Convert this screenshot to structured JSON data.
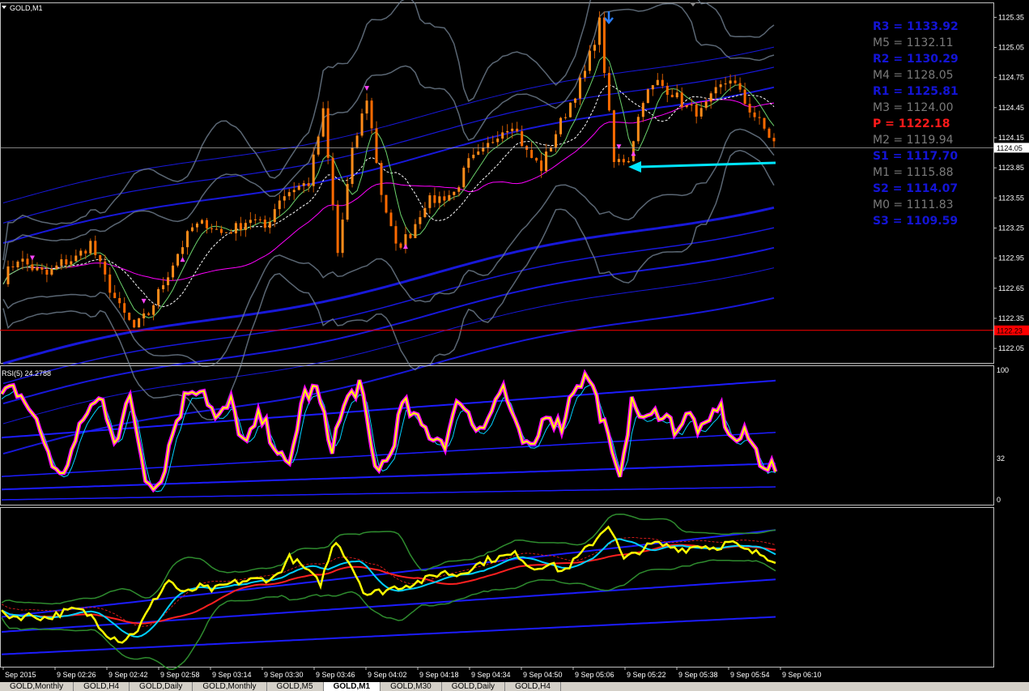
{
  "title": "GOLD,M1",
  "colors": {
    "background": "#000000",
    "axis": "#c0c0c0",
    "up_candle": "#ff8c1a",
    "down_candle": "#ff6a00",
    "bollinger": "#708090",
    "envelope": "#1c1cff",
    "magenta_ma": "#ff00ff",
    "white_ma": "#ffffff",
    "green_ma": "#6bd26b",
    "rsi_yellow": "#ffff00",
    "rsi_cyan": "#00d0ff",
    "red_line": "#ff0000",
    "cyan_arrow": "#00e5ff"
  },
  "chart_data": [
    {
      "type": "candlestick",
      "title": "GOLD,M1",
      "y_ticks": [
        "1125.35",
        "1125.05",
        "1124.75",
        "1124.45",
        "1124.15",
        "1123.85",
        "1123.55",
        "1123.25",
        "1122.95",
        "1122.65",
        "1122.35",
        "1122.05"
      ],
      "y_range": [
        1121.97,
        1125.45
      ],
      "current_price": "1124.05",
      "current_price_value": 1124.05,
      "red_level": "1122.23",
      "red_level_value": 1122.23,
      "x_ticks": [
        "Sep 2015",
        "9 Sep 02:26",
        "9 Sep 02:42",
        "9 Sep 02:58",
        "9 Sep 03:14",
        "9 Sep 03:30",
        "9 Sep 03:46",
        "9 Sep 04:02",
        "9 Sep 04:18",
        "9 Sep 04:34",
        "9 Sep 04:50",
        "9 Sep 05:06",
        "9 Sep 05:22",
        "9 Sep 05:38",
        "9 Sep 05:54",
        "9 Sep 06:10"
      ],
      "price_path": [
        1122.75,
        1122.95,
        1122.85,
        1122.78,
        1122.9,
        1122.95,
        1123.1,
        1122.75,
        1122.45,
        1122.25,
        1122.4,
        1122.7,
        1123.0,
        1123.25,
        1123.3,
        1123.2,
        1123.25,
        1123.35,
        1123.25,
        1123.55,
        1123.65,
        1123.7,
        1124.4,
        1123.0,
        1124.0,
        1124.55,
        1123.6,
        1123.05,
        1123.2,
        1123.5,
        1123.55,
        1123.6,
        1123.9,
        1124.0,
        1124.2,
        1124.3,
        1124.0,
        1123.85,
        1124.2,
        1124.5,
        1124.8,
        1125.3,
        1123.9,
        1123.95,
        1124.55,
        1124.7,
        1124.6,
        1124.45,
        1124.4,
        1124.6,
        1124.75,
        1124.5,
        1124.3,
        1124.1
      ],
      "pivots": [
        {
          "label": "R3 = 1133.92",
          "color": "#1414d6"
        },
        {
          "label": "M5 = 1132.11",
          "color": "#7a7a7a"
        },
        {
          "label": "R2 = 1130.29",
          "color": "#1414d6"
        },
        {
          "label": "M4 = 1128.05",
          "color": "#7a7a7a"
        },
        {
          "label": "R1 = 1125.81",
          "color": "#1414d6"
        },
        {
          "label": "M3 = 1124.00",
          "color": "#7a7a7a"
        },
        {
          "label": "P  = 1122.18",
          "color": "#ff1a1a"
        },
        {
          "label": "M2 = 1119.94",
          "color": "#7a7a7a"
        },
        {
          "label": "S1 = 1117.70",
          "color": "#1414d6"
        },
        {
          "label": "M1 = 1115.88",
          "color": "#7a7a7a"
        },
        {
          "label": "S2 = 1114.07",
          "color": "#1414d6"
        },
        {
          "label": "M0 = 1111.83",
          "color": "#7a7a7a"
        },
        {
          "label": "S3 = 1109.59",
          "color": "#1414d6"
        }
      ]
    },
    {
      "type": "line",
      "title": "RSI(5) 24.2788",
      "y_ticks": [
        "100",
        "32",
        "0"
      ],
      "y_tick_values": [
        100,
        32,
        0
      ],
      "y_range": [
        0,
        100
      ],
      "series": [
        {
          "values": [
            80,
            85,
            70,
            45,
            15,
            40,
            70,
            78,
            45,
            80,
            20,
            10,
            55,
            85,
            88,
            60,
            75,
            40,
            65,
            45,
            20,
            80,
            85,
            40,
            75,
            90,
            25,
            30,
            75,
            60,
            50,
            45,
            80,
            55,
            65,
            88,
            50,
            35,
            70,
            55,
            90,
            95,
            60,
            15,
            75,
            60,
            70,
            55,
            65,
            50,
            75,
            45,
            50,
            30,
            24
          ]
        }
      ]
    },
    {
      "type": "line",
      "title": "",
      "series": [
        {
          "values": [
            0.32,
            0.3,
            0.31,
            0.29,
            0.33,
            0.35,
            0.3,
            0.18,
            0.14,
            0.22,
            0.4,
            0.55,
            0.45,
            0.5,
            0.48,
            0.52,
            0.54,
            0.55,
            0.56,
            0.7,
            0.62,
            0.52,
            0.82,
            0.65,
            0.45,
            0.47,
            0.5,
            0.52,
            0.55,
            0.6,
            0.58,
            0.63,
            0.68,
            0.7,
            0.72,
            0.62,
            0.66,
            0.6,
            0.7,
            0.8,
            0.92,
            0.68,
            0.74,
            0.79,
            0.77,
            0.75,
            0.78,
            0.76,
            0.8,
            0.74,
            0.72,
            0.68
          ]
        }
      ]
    }
  ],
  "tabs": [
    {
      "label": "GOLD,Monthly",
      "active": false
    },
    {
      "label": "GOLD,H4",
      "active": false
    },
    {
      "label": "GOLD,Daily",
      "active": false
    },
    {
      "label": "GOLD,Monthly",
      "active": false
    },
    {
      "label": "GOLD,M5",
      "active": false
    },
    {
      "label": "GOLD,M1",
      "active": true
    },
    {
      "label": "GOLD,M30",
      "active": false
    },
    {
      "label": "GOLD,Daily",
      "active": false
    },
    {
      "label": "GOLD,H4",
      "active": false
    }
  ]
}
